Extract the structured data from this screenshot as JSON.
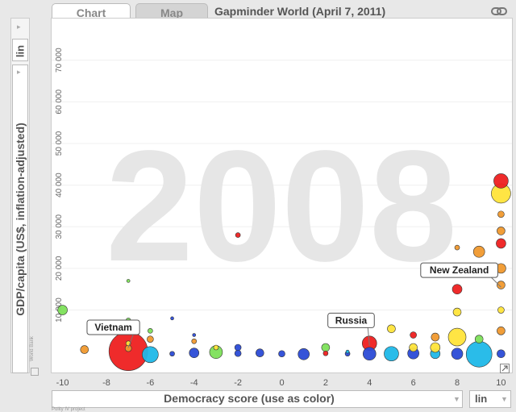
{
  "tabs": [
    {
      "label": "Chart"
    },
    {
      "label": "Map"
    }
  ],
  "title": "Gapminder World (April 7, 2011)",
  "year": "2008",
  "y_scale": "lin",
  "x_scale": "lin",
  "y_axis_label": "GDP/capita (US$, inflation-adjusted)",
  "x_axis_label": "Democracy score (use as color)",
  "source_y": "World Bank",
  "source_x": "Polity IV project",
  "chart_data": {
    "type": "scatter",
    "xlabel": "Democracy score (use as color)",
    "ylabel": "GDP/capita (US$, inflation-adjusted)",
    "xlim": [
      -10.5,
      10.5
    ],
    "ylim": [
      -5000,
      80000
    ],
    "x_ticks": [
      "-10",
      "-8",
      "-6",
      "-4",
      "-2",
      "0",
      "2",
      "4",
      "6",
      "8",
      "10"
    ],
    "y_ticks": [
      "10 000",
      "20 000",
      "30 000",
      "40 000",
      "50 000",
      "60 000",
      "70 000"
    ],
    "labels": [
      {
        "text": "Vietnam",
        "x": -7,
        "y": 1000
      },
      {
        "text": "Russia",
        "x": 4,
        "y": 1500
      },
      {
        "text": "New Zealand",
        "x": 10,
        "y": 15500
      }
    ],
    "points": [
      {
        "x": -10,
        "y": 10000,
        "r": 6,
        "color": "#7de05a"
      },
      {
        "x": -9,
        "y": 500,
        "r": 5,
        "color": "#f0992e"
      },
      {
        "x": -7,
        "y": 17000,
        "r": 2,
        "color": "#7de05a"
      },
      {
        "x": -7,
        "y": 7500,
        "r": 3,
        "color": "#7de05a"
      },
      {
        "x": -7,
        "y": 100,
        "r": 24,
        "color": "#ee2020"
      },
      {
        "x": -7,
        "y": 2000,
        "r": 3,
        "color": "#ffe43a"
      },
      {
        "x": -7,
        "y": 800,
        "r": 4,
        "color": "#f0992e"
      },
      {
        "x": -6,
        "y": 5000,
        "r": 3,
        "color": "#7de05a"
      },
      {
        "x": -6,
        "y": 3000,
        "r": 4,
        "color": "#f0992e"
      },
      {
        "x": -6,
        "y": -700,
        "r": 10,
        "color": "#1fb8e8"
      },
      {
        "x": -5,
        "y": 8000,
        "r": 2,
        "color": "#2b4bd6"
      },
      {
        "x": -5,
        "y": -500,
        "r": 3,
        "color": "#2b4bd6"
      },
      {
        "x": -4,
        "y": 4000,
        "r": 2,
        "color": "#2b4bd6"
      },
      {
        "x": -4,
        "y": 2500,
        "r": 3,
        "color": "#f0992e"
      },
      {
        "x": -4,
        "y": -300,
        "r": 6,
        "color": "#2b4bd6"
      },
      {
        "x": -3,
        "y": -100,
        "r": 8,
        "color": "#7de05a"
      },
      {
        "x": -3,
        "y": 1000,
        "r": 3,
        "color": "#ffe43a"
      },
      {
        "x": -2,
        "y": 28000,
        "r": 3,
        "color": "#ee2020"
      },
      {
        "x": -2,
        "y": 1000,
        "r": 4,
        "color": "#2b4bd6"
      },
      {
        "x": -2,
        "y": -400,
        "r": 4,
        "color": "#2b4bd6"
      },
      {
        "x": -1,
        "y": -300,
        "r": 5,
        "color": "#2b4bd6"
      },
      {
        "x": 0,
        "y": -500,
        "r": 4,
        "color": "#2b4bd6"
      },
      {
        "x": 1,
        "y": -600,
        "r": 7,
        "color": "#2b4bd6"
      },
      {
        "x": 2,
        "y": -400,
        "r": 3,
        "color": "#ee2020"
      },
      {
        "x": 2,
        "y": 1000,
        "r": 5,
        "color": "#7de05a"
      },
      {
        "x": 3,
        "y": -500,
        "r": 3,
        "color": "#2b4bd6"
      },
      {
        "x": 3,
        "y": 0,
        "r": 2,
        "color": "#1fb8e8"
      },
      {
        "x": 4,
        "y": 2000,
        "r": 9,
        "color": "#ee2020"
      },
      {
        "x": 4,
        "y": -500,
        "r": 8,
        "color": "#2b4bd6"
      },
      {
        "x": 5,
        "y": 5500,
        "r": 5,
        "color": "#ffe43a"
      },
      {
        "x": 5,
        "y": -500,
        "r": 9,
        "color": "#1fb8e8"
      },
      {
        "x": 6,
        "y": 4000,
        "r": 4,
        "color": "#ee2020"
      },
      {
        "x": 6,
        "y": 1000,
        "r": 5,
        "color": "#ffe43a"
      },
      {
        "x": 6,
        "y": -400,
        "r": 7,
        "color": "#2b4bd6"
      },
      {
        "x": 7,
        "y": 3500,
        "r": 5,
        "color": "#f0992e"
      },
      {
        "x": 7,
        "y": -500,
        "r": 6,
        "color": "#1fb8e8"
      },
      {
        "x": 7,
        "y": 1000,
        "r": 6,
        "color": "#ffe43a"
      },
      {
        "x": 8,
        "y": 25000,
        "r": 3,
        "color": "#f0992e"
      },
      {
        "x": 8,
        "y": 15000,
        "r": 6,
        "color": "#ee2020"
      },
      {
        "x": 8,
        "y": 9500,
        "r": 5,
        "color": "#ffe43a"
      },
      {
        "x": 8,
        "y": 3500,
        "r": 11,
        "color": "#ffe43a"
      },
      {
        "x": 8,
        "y": -500,
        "r": 7,
        "color": "#2b4bd6"
      },
      {
        "x": 9,
        "y": 24000,
        "r": 7,
        "color": "#f0992e"
      },
      {
        "x": 9,
        "y": 3000,
        "r": 5,
        "color": "#7de05a"
      },
      {
        "x": 9,
        "y": -600,
        "r": 16,
        "color": "#1fb8e8"
      },
      {
        "x": 10,
        "y": 41000,
        "r": 9,
        "color": "#ee2020"
      },
      {
        "x": 10,
        "y": 38000,
        "r": 12,
        "color": "#ffe43a"
      },
      {
        "x": 10,
        "y": 33000,
        "r": 4,
        "color": "#f0992e"
      },
      {
        "x": 10,
        "y": 29000,
        "r": 5,
        "color": "#f0992e"
      },
      {
        "x": 10,
        "y": 26000,
        "r": 6,
        "color": "#ee2020"
      },
      {
        "x": 10,
        "y": 20000,
        "r": 6,
        "color": "#f0992e"
      },
      {
        "x": 10,
        "y": 16000,
        "r": 5,
        "color": "#f0992e"
      },
      {
        "x": 10,
        "y": 10000,
        "r": 4,
        "color": "#ffe43a"
      },
      {
        "x": 10,
        "y": 5000,
        "r": 5,
        "color": "#f0992e"
      },
      {
        "x": 10,
        "y": -500,
        "r": 5,
        "color": "#2b4bd6"
      }
    ]
  }
}
